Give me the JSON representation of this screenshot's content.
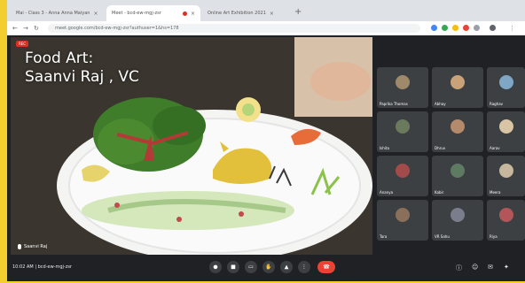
{
  "browser": {
    "tabs": [
      {
        "label": "Mai - Class 3 - Anna Anna Maiyan"
      },
      {
        "label": "Meet - bcd-ew-mgj-zsr"
      },
      {
        "label": "Online Art Exhibition 2021"
      }
    ],
    "url": "meet.google.com/bcd-ew-mgj-zsr?authuser=1&hs=178"
  },
  "presentation": {
    "caption_line1": "Food Art:",
    "caption_line2": "Saanvi Raj , VC",
    "presenter_name": "Saanvi Raj",
    "recording_label": "REC"
  },
  "participants": [
    {
      "name": "Paprika Thomas",
      "color": "#9e8a6a"
    },
    {
      "name": "Abhay",
      "color": "#c9a27a"
    },
    {
      "name": "Raghav",
      "color": "#7fa6c4"
    },
    {
      "name": "Ishita",
      "color": "#6b7a5c"
    },
    {
      "name": "Dhruv",
      "color": "#b48a6d"
    },
    {
      "name": "Aarav",
      "color": "#d9c4a5"
    },
    {
      "name": "Ananya",
      "color": "#a34a4a"
    },
    {
      "name": "Kabir",
      "color": "#5f7a63"
    },
    {
      "name": "Meera",
      "color": "#c7b79c"
    },
    {
      "name": "Tara",
      "color": "#8a6f5a"
    },
    {
      "name": "VR Sahu",
      "color": "#7a7d8c"
    },
    {
      "name": "Riya",
      "color": "#b2565a"
    }
  ],
  "grid_footer": "",
  "bottom": {
    "time_meeting": "10:02 AM | bcd-ew-mgj-zsr"
  },
  "colors": {
    "accent_red": "#ea4335",
    "frame_yellow": "#f2cf2e"
  }
}
